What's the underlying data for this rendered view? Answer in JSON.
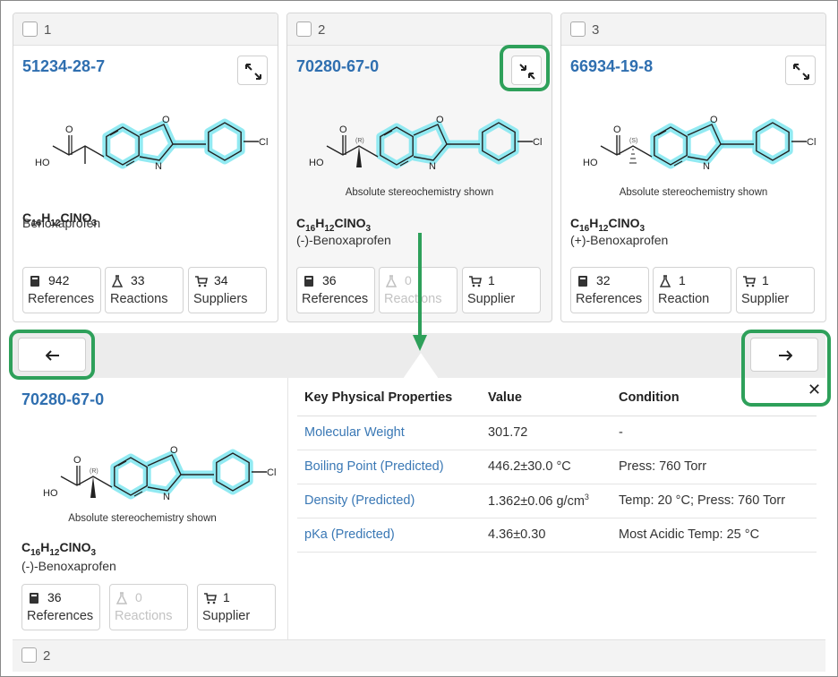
{
  "cards": [
    {
      "index": "1",
      "cas": "51234-28-7",
      "stereo": "",
      "formula": {
        "c": "16",
        "h": "12",
        "rest": "ClNO",
        "o": "3"
      },
      "name": "Benoxaprofen",
      "expand_icon": "expand-arrows-icon",
      "stats": [
        {
          "count": "942",
          "label": "References",
          "icon": "book-icon"
        },
        {
          "count": "33",
          "label": "Reactions",
          "icon": "flask-icon"
        },
        {
          "count": "34",
          "label": "Suppliers",
          "icon": "cart-icon"
        }
      ]
    },
    {
      "index": "2",
      "cas": "70280-67-0",
      "stereo": "Absolute stereochemistry shown",
      "stereo_label": "(R)",
      "formula": {
        "c": "16",
        "h": "12",
        "rest": "ClNO",
        "o": "3"
      },
      "name": "(-)-Benoxaprofen",
      "expand_icon": "collapse-arrows-icon",
      "stats": [
        {
          "count": "36",
          "label": "References",
          "icon": "book-icon"
        },
        {
          "count": "0",
          "label": "Reactions",
          "icon": "flask-icon",
          "disabled": true
        },
        {
          "count": "1",
          "label": "Supplier",
          "icon": "cart-icon"
        }
      ]
    },
    {
      "index": "3",
      "cas": "66934-19-8",
      "stereo": "Absolute stereochemistry shown",
      "stereo_label": "(S)",
      "formula": {
        "c": "16",
        "h": "12",
        "rest": "ClNO",
        "o": "3"
      },
      "name": "(+)-Benoxaprofen",
      "expand_icon": "expand-arrows-icon",
      "stats": [
        {
          "count": "32",
          "label": "References",
          "icon": "book-icon"
        },
        {
          "count": "1",
          "label": "Reaction",
          "icon": "flask-icon"
        },
        {
          "count": "1",
          "label": "Supplier",
          "icon": "cart-icon"
        }
      ]
    }
  ],
  "molecule": {
    "atom_o": "O",
    "atom_n": "N",
    "atom_ho": "HO",
    "atom_cl": "Cl"
  },
  "nav": {
    "prev_icon": "arrow-left-icon",
    "next_icon": "arrow-right-icon"
  },
  "detail": {
    "cas": "70280-67-0",
    "stereo": "Absolute stereochemistry shown",
    "stereo_label": "(R)",
    "formula": {
      "c": "16",
      "h": "12",
      "rest": "ClNO",
      "o": "3"
    },
    "name": "(-)-Benoxaprofen",
    "stats": [
      {
        "count": "36",
        "label": "References",
        "icon": "book-icon"
      },
      {
        "count": "0",
        "label": "Reactions",
        "icon": "flask-icon",
        "disabled": true
      },
      {
        "count": "1",
        "label": "Supplier",
        "icon": "cart-icon"
      }
    ],
    "close_label": "✕",
    "table": {
      "headers": [
        "Key Physical Properties",
        "Value",
        "Condition"
      ],
      "rows": [
        {
          "property": "Molecular Weight",
          "value": "301.72",
          "condition": "-"
        },
        {
          "property": "Boiling Point (Predicted)",
          "value": "446.2±30.0 °C",
          "condition": "Press: 760 Torr"
        },
        {
          "property": "Density (Predicted)",
          "value": "1.362±0.06 g/cm",
          "value_sup": "3",
          "condition": "Temp: 20 °C; Press: 760 Torr"
        },
        {
          "property": "pKa (Predicted)",
          "value": "4.36±0.30",
          "condition": "Most Acidic Temp: 25 °C"
        }
      ]
    }
  },
  "next_card": {
    "index": "2"
  },
  "colors": {
    "link": "#2f6fb0",
    "highlight": "#2ea05a",
    "arrow": "#2ea05a",
    "molecule_glow": "#7fe6f0"
  }
}
